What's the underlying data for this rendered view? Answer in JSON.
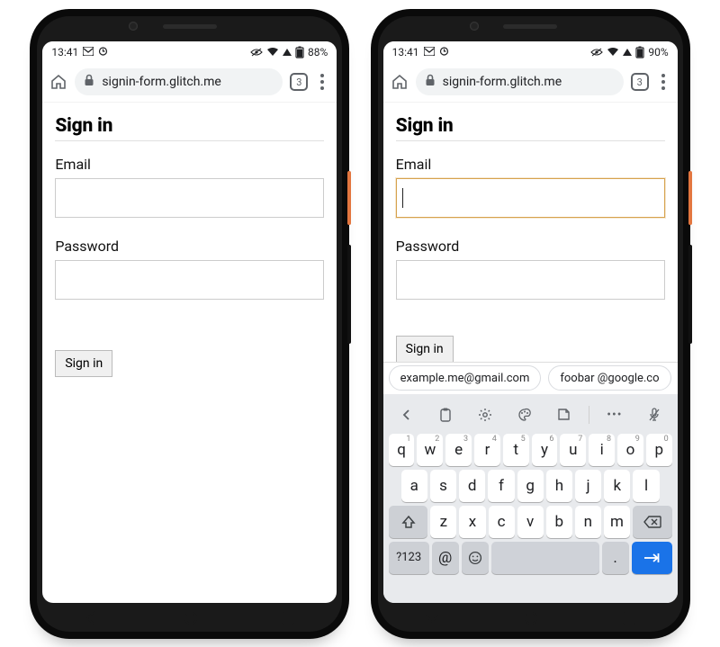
{
  "phones": {
    "left": {
      "status": {
        "time": "13:41",
        "battery": "88%"
      },
      "url": "signin-form.glitch.me",
      "tab_count": "3",
      "page": {
        "heading": "Sign in",
        "email_label": "Email",
        "email_value": "",
        "password_label": "Password",
        "password_value": "",
        "submit_label": "Sign in"
      }
    },
    "right": {
      "status": {
        "time": "13:41",
        "battery": "90%"
      },
      "url": "signin-form.glitch.me",
      "tab_count": "3",
      "page": {
        "heading": "Sign in",
        "email_label": "Email",
        "email_value": "",
        "password_label": "Password",
        "password_value": "",
        "submit_label": "Sign in"
      },
      "autofill": {
        "suggestions": [
          "example.me@gmail.com",
          "foobar @google.co"
        ]
      },
      "keyboard": {
        "row1": [
          {
            "k": "q",
            "s": "1"
          },
          {
            "k": "w",
            "s": "2"
          },
          {
            "k": "e",
            "s": "3"
          },
          {
            "k": "r",
            "s": "4"
          },
          {
            "k": "t",
            "s": "5"
          },
          {
            "k": "y",
            "s": "6"
          },
          {
            "k": "u",
            "s": "7"
          },
          {
            "k": "i",
            "s": "8"
          },
          {
            "k": "o",
            "s": "9"
          },
          {
            "k": "p",
            "s": "0"
          }
        ],
        "row2": [
          "a",
          "s",
          "d",
          "f",
          "g",
          "h",
          "j",
          "k",
          "l"
        ],
        "row3": [
          "z",
          "x",
          "c",
          "v",
          "b",
          "n",
          "m"
        ],
        "sym_label": "?123",
        "at_label": "@",
        "period_label": "."
      }
    }
  }
}
